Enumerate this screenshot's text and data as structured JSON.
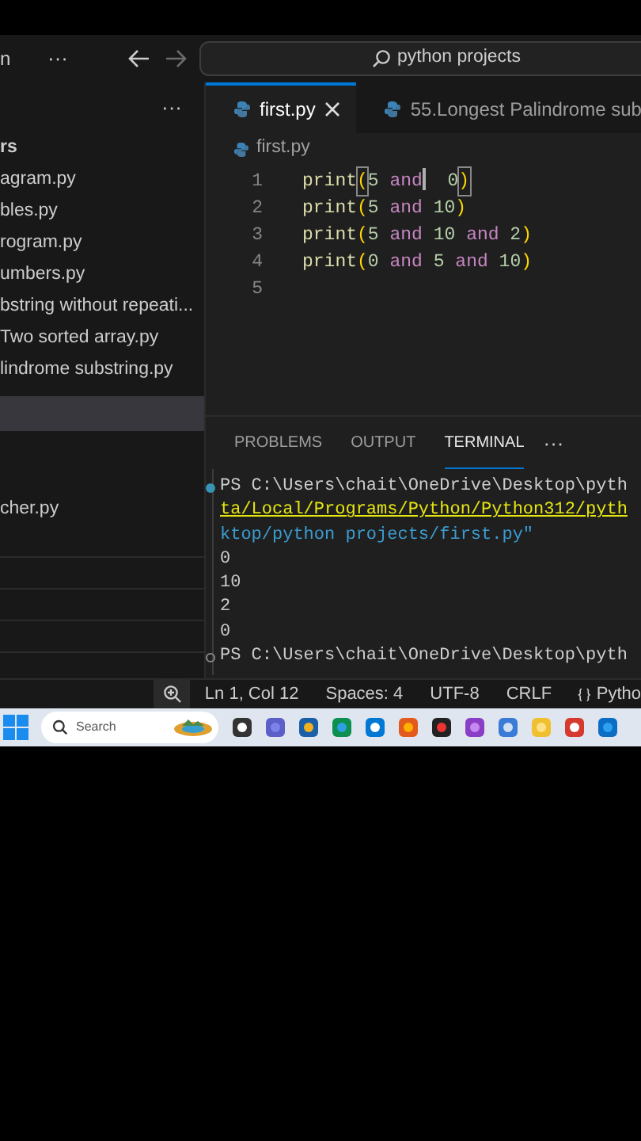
{
  "title_bar": {
    "menu_fragment": "n",
    "more": "···",
    "search": "python projects"
  },
  "sidebar": {
    "more": "···",
    "section": "rs",
    "items": [
      {
        "label": "agram.py",
        "selected": false
      },
      {
        "label": "bles.py",
        "selected": false
      },
      {
        "label": "rogram.py",
        "selected": false
      },
      {
        "label": "umbers.py",
        "selected": false
      },
      {
        "label": "bstring without repeati...",
        "selected": false
      },
      {
        "label": "Two sorted array.py",
        "selected": false
      },
      {
        "label": "lindrome substring.py",
        "selected": false
      },
      {
        "selected": true
      },
      {
        "label": "cher.py",
        "selected": false
      }
    ]
  },
  "tabs": [
    {
      "label": "first.py",
      "selected": true
    },
    {
      "label": "55.Longest Palindrome sub",
      "selected": false
    }
  ],
  "breadcrumb": "first.py",
  "code_lines": [
    {
      "number": "1",
      "tokens": [
        {
          "kind": "fn",
          "text": "print"
        },
        {
          "kind": "paren",
          "text": "(",
          "matched": true
        },
        {
          "kind": "num",
          "text": "5 "
        },
        {
          "kind": "kw",
          "text": "and",
          "cursor": true
        },
        {
          "kind": "num",
          "text": "  0"
        },
        {
          "kind": "paren",
          "text": ")",
          "matched": true
        }
      ]
    },
    {
      "number": "2",
      "tokens": [
        {
          "kind": "fn",
          "text": "print"
        },
        {
          "kind": "paren",
          "text": "("
        },
        {
          "kind": "num",
          "text": "5 "
        },
        {
          "kind": "kw",
          "text": "and"
        },
        {
          "kind": "num",
          "text": " 10"
        },
        {
          "kind": "paren",
          "text": ")"
        }
      ]
    },
    {
      "number": "3",
      "tokens": [
        {
          "kind": "fn",
          "text": "print"
        },
        {
          "kind": "paren",
          "text": "("
        },
        {
          "kind": "num",
          "text": "5 "
        },
        {
          "kind": "kw",
          "text": "and"
        },
        {
          "kind": "num",
          "text": " 10 "
        },
        {
          "kind": "kw",
          "text": "and"
        },
        {
          "kind": "num",
          "text": " 2"
        },
        {
          "kind": "paren",
          "text": ")"
        }
      ]
    },
    {
      "number": "4",
      "tokens": [
        {
          "kind": "fn",
          "text": "print"
        },
        {
          "kind": "paren",
          "text": "("
        },
        {
          "kind": "num",
          "text": "0 "
        },
        {
          "kind": "kw",
          "text": "and"
        },
        {
          "kind": "num",
          "text": " 5 "
        },
        {
          "kind": "kw",
          "text": "and"
        },
        {
          "kind": "num",
          "text": " 10"
        },
        {
          "kind": "paren",
          "text": ")"
        }
      ]
    },
    {
      "number": "5"
    }
  ],
  "panel_tabs": [
    {
      "label": "PROBLEMS",
      "selected": false
    },
    {
      "label": "OUTPUT",
      "selected": false
    },
    {
      "label": "TERMINAL",
      "selected": true
    }
  ],
  "panel_more": "···",
  "terminal": [
    {
      "kind": "prompt",
      "success": true,
      "text": "PS C:\\Users\\chait\\OneDrive\\Desktop\\pyth"
    },
    {
      "kind": "path",
      "text": "ta/Local/Programs/Python/Python312/pyth"
    },
    {
      "kind": "string",
      "text": "ktop/python projects/first.py\""
    },
    {
      "kind": "output",
      "text": "0"
    },
    {
      "kind": "output",
      "text": "10"
    },
    {
      "kind": "output",
      "text": "2"
    },
    {
      "kind": "output",
      "text": "0"
    },
    {
      "kind": "prompt",
      "success": false,
      "text": "PS C:\\Users\\chait\\OneDrive\\Desktop\\pyth"
    }
  ],
  "status_bar": [
    "Ln 1, Col 12",
    "Spaces: 4",
    "UTF-8",
    "CRLF"
  ],
  "language": "Pytho",
  "taskbar": {
    "search": "Search"
  }
}
